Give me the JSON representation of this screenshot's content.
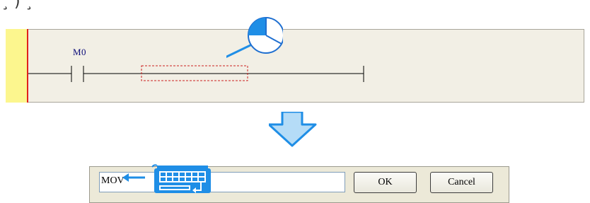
{
  "ladder": {
    "contact_label": "M0"
  },
  "dialog": {
    "input_value": "MOV",
    "ok_label": "OK",
    "cancel_label": "Cancel"
  },
  "colors": {
    "rail": "#e0201c",
    "left_bar": "#fcf68e",
    "panel": "#f2efe5",
    "accent_blue": "#1f8ee6",
    "selection_box": "#cc2020"
  },
  "icons": [
    "mouse-click-icon",
    "down-arrow-icon",
    "keyboard-icon",
    "left-arrow-icon"
  ]
}
